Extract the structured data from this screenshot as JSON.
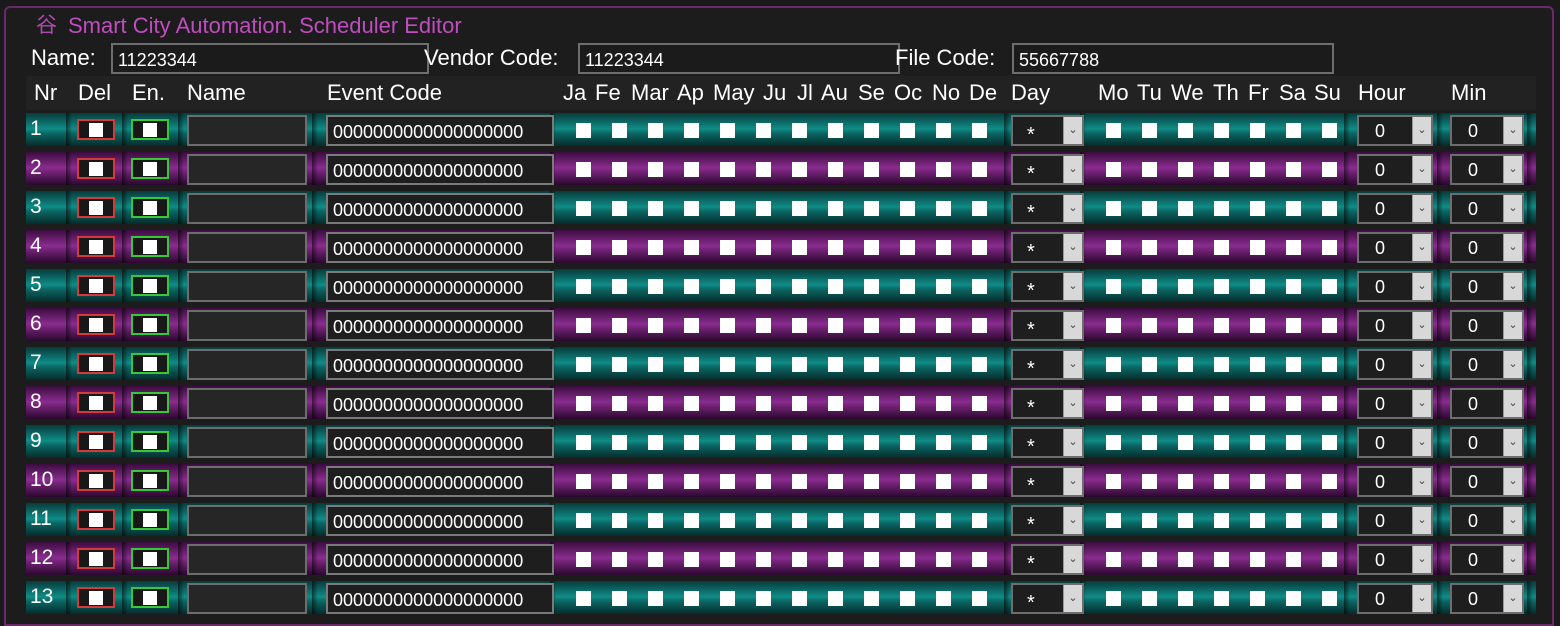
{
  "window": {
    "title": "Smart City Automation. Scheduler Editor",
    "icon": "app-icon"
  },
  "info": {
    "name_label": "Name:",
    "name_value": "11223344",
    "vendor_label": "Vendor Code:",
    "vendor_value": "11223344",
    "file_label": "File Code:",
    "file_value": "55667788"
  },
  "headers": {
    "nr": "Nr",
    "del": "Del",
    "en": "En.",
    "name": "Name",
    "event_code": "Event Code",
    "months": [
      "Ja",
      "Fe",
      "Mar",
      "Ap",
      "May",
      "Ju",
      "Jl",
      "Au",
      "Se",
      "Oc",
      "No",
      "De"
    ],
    "day": "Day",
    "weekdays": [
      "Mo",
      "Tu",
      "We",
      "Th",
      "Fr",
      "Sa",
      "Su"
    ],
    "hour": "Hour",
    "min": "Min"
  },
  "rows": [
    {
      "nr": "1",
      "name": "",
      "event_code": "0000000000000000000",
      "day": "*",
      "hour": "0",
      "min": "0"
    },
    {
      "nr": "2",
      "name": "",
      "event_code": "0000000000000000000",
      "day": "*",
      "hour": "0",
      "min": "0"
    },
    {
      "nr": "3",
      "name": "",
      "event_code": "0000000000000000000",
      "day": "*",
      "hour": "0",
      "min": "0"
    },
    {
      "nr": "4",
      "name": "",
      "event_code": "0000000000000000000",
      "day": "*",
      "hour": "0",
      "min": "0"
    },
    {
      "nr": "5",
      "name": "",
      "event_code": "0000000000000000000",
      "day": "*",
      "hour": "0",
      "min": "0"
    },
    {
      "nr": "6",
      "name": "",
      "event_code": "0000000000000000000",
      "day": "*",
      "hour": "0",
      "min": "0"
    },
    {
      "nr": "7",
      "name": "",
      "event_code": "0000000000000000000",
      "day": "*",
      "hour": "0",
      "min": "0"
    },
    {
      "nr": "8",
      "name": "",
      "event_code": "0000000000000000000",
      "day": "*",
      "hour": "0",
      "min": "0"
    },
    {
      "nr": "9",
      "name": "",
      "event_code": "0000000000000000000",
      "day": "*",
      "hour": "0",
      "min": "0"
    },
    {
      "nr": "10",
      "name": "",
      "event_code": "0000000000000000000",
      "day": "*",
      "hour": "0",
      "min": "0"
    },
    {
      "nr": "11",
      "name": "",
      "event_code": "0000000000000000000",
      "day": "*",
      "hour": "0",
      "min": "0"
    },
    {
      "nr": "12",
      "name": "",
      "event_code": "0000000000000000000",
      "day": "*",
      "hour": "0",
      "min": "0"
    },
    {
      "nr": "13",
      "name": "",
      "event_code": "0000000000000000000",
      "day": "*",
      "hour": "0",
      "min": "0"
    }
  ],
  "colors": {
    "accent": "#c04cc0",
    "row_teal": "#0f8c86",
    "row_purple": "#8a2c90",
    "del_frame": "#d53a3a",
    "en_frame": "#39c639"
  }
}
